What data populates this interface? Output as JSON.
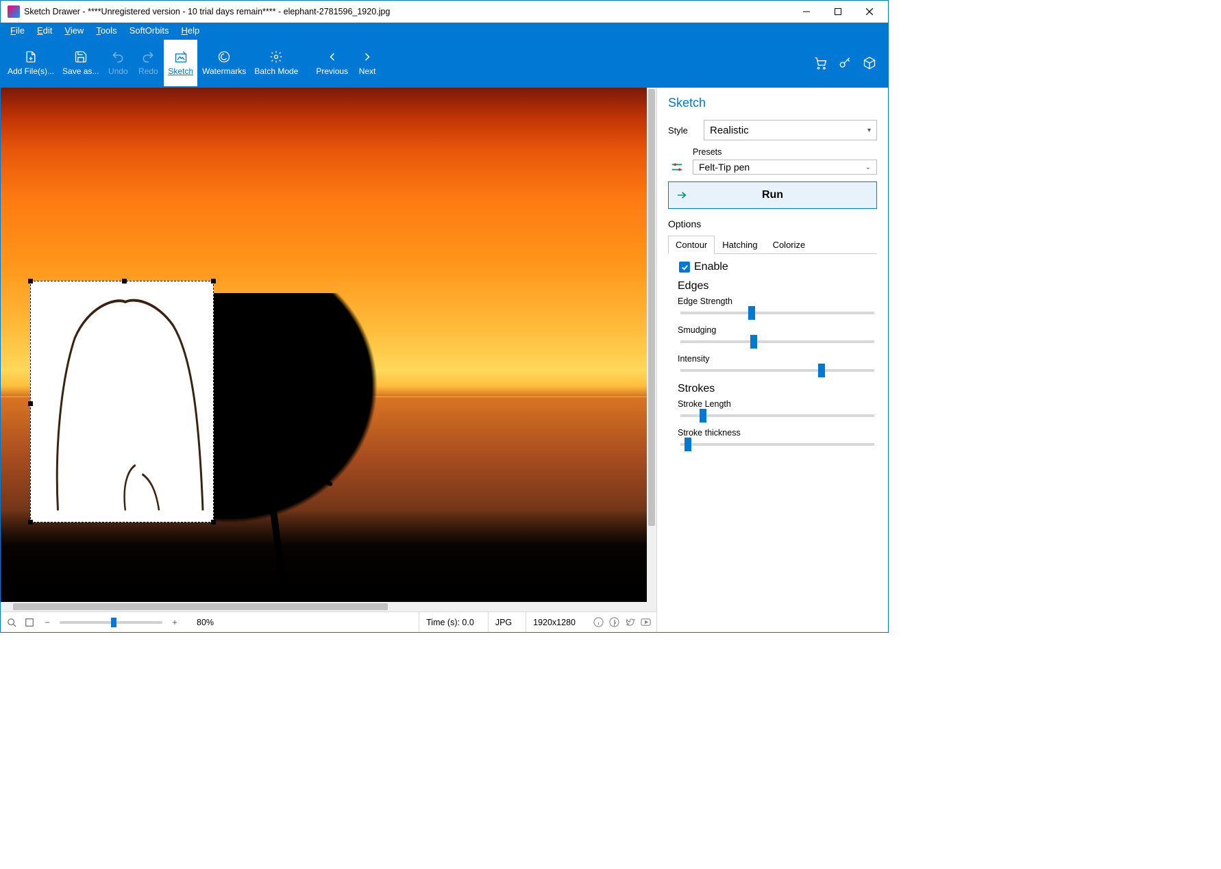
{
  "title": "Sketch Drawer - ****Unregistered version - 10 trial days remain**** - elephant-2781596_1920.jpg",
  "menu": {
    "file": "File",
    "edit": "Edit",
    "view": "View",
    "tools": "Tools",
    "softorbits": "SoftOrbits",
    "help": "Help"
  },
  "toolbar": {
    "addfiles": "Add File(s)...",
    "saveas": "Save as...",
    "undo": "Undo",
    "redo": "Redo",
    "sketch": "Sketch",
    "watermarks": "Watermarks",
    "batch": "Batch Mode",
    "previous": "Previous",
    "next": "Next"
  },
  "zoom": {
    "percent": "80%",
    "minus": "−",
    "plus": "+"
  },
  "status": {
    "time": "Time (s): 0.0",
    "format": "JPG",
    "dims": "1920x1280"
  },
  "panel": {
    "heading": "Sketch",
    "style_label": "Style",
    "style_value": "Realistic",
    "presets_label": "Presets",
    "presets_value": "Felt-Tip pen",
    "run": "Run",
    "options": "Options",
    "tabs": {
      "contour": "Contour",
      "hatching": "Hatching",
      "colorize": "Colorize"
    },
    "enable": "Enable",
    "edges": "Edges",
    "edge_strength": "Edge Strength",
    "smudging": "Smudging",
    "intensity": "Intensity",
    "strokes": "Strokes",
    "stroke_length": "Stroke Length",
    "stroke_thickness": "Stroke thickness"
  },
  "sliders": {
    "edge_strength": 35,
    "smudging": 36,
    "intensity": 71,
    "stroke_length": 10,
    "stroke_thickness": 2,
    "zoom": 50
  }
}
